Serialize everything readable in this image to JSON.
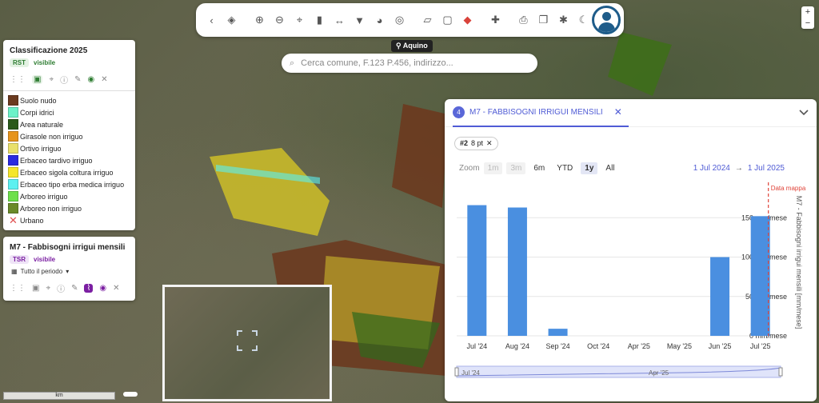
{
  "toolbar": {
    "icons": [
      "back-icon",
      "layers-icon",
      "zoom-in-icon",
      "zoom-out-icon",
      "locate-icon",
      "bookmark-icon",
      "measure-icon",
      "filter-icon",
      "palette-icon",
      "target-icon",
      "ruler-icon",
      "select-area-icon",
      "eraser-icon",
      "plugin-icon",
      "print-icon",
      "book-icon",
      "bug-icon",
      "moon-icon"
    ],
    "user": "user-icon"
  },
  "place_label": "Aquino",
  "search": {
    "placeholder": "Cerca comune, F.123 P.456, indirizzo..."
  },
  "layer1": {
    "title": "Classificazione 2025",
    "badge": "RST",
    "status": "visibile",
    "legend": [
      {
        "label": "Suolo nudo",
        "color": "#6b3a1f"
      },
      {
        "label": "Corpi idrici",
        "color": "#6cf2c8"
      },
      {
        "label": "Area naturale",
        "color": "#2a5a1a"
      },
      {
        "label": "Girasole non irriguo",
        "color": "#e6941c"
      },
      {
        "label": "Ortivo irriguo",
        "color": "#e9e06a"
      },
      {
        "label": "Erbaceo tardivo irriguo",
        "color": "#2a2ae0"
      },
      {
        "label": "Erbaceo sigola coltura irriguo",
        "color": "#f5e62a"
      },
      {
        "label": "Erbaceo tipo erba medica irriguo",
        "color": "#5cf0f0"
      },
      {
        "label": "Arboreo irriguo",
        "color": "#6de04a"
      },
      {
        "label": "Arboreo non irriguo",
        "color": "#6b8a2a"
      },
      {
        "label": "Urbano",
        "color": "#e05050"
      }
    ]
  },
  "layer2": {
    "title": "M7 - Fabbisogni irrigui mensili",
    "badge": "TSR",
    "status": "visibile",
    "period": "Tutto il periodo"
  },
  "scale": {
    "label": "km"
  },
  "chart_panel": {
    "tab_number": "4",
    "tab_title": "M7 - FABBISOGNI IRRIGUI MENSILI",
    "chip_id": "#2",
    "chip_pts": "8 pt",
    "zoom_label": "Zoom",
    "zoom_buttons": [
      "1m",
      "3m",
      "6m",
      "YTD",
      "1y",
      "All"
    ],
    "range_start": "1 Jul 2024",
    "range_arrow": "→",
    "range_end": "1 Jul 2025"
  },
  "chart_data": {
    "type": "bar",
    "categories": [
      "Jul '24",
      "Aug '24",
      "Sep '24",
      "Oct '24",
      "Apr '25",
      "May '25",
      "Jun '25",
      "Jul '25"
    ],
    "values": [
      166,
      163,
      9,
      0,
      0,
      0,
      100,
      152
    ],
    "ylabel": "M7 - Fabbisogni irrigui mensili [mm/mese]",
    "yticks": [
      "0 mm/mese",
      "50 mm/mese",
      "100 mm/mese",
      "150 mm/mese"
    ],
    "ylim": [
      0,
      195
    ],
    "bar_color": "#4a8fe0",
    "marker_label": "Data mappa",
    "marker_color": "#e0443a",
    "navigator_labels": [
      "Jul '24",
      "Apr '25"
    ]
  }
}
